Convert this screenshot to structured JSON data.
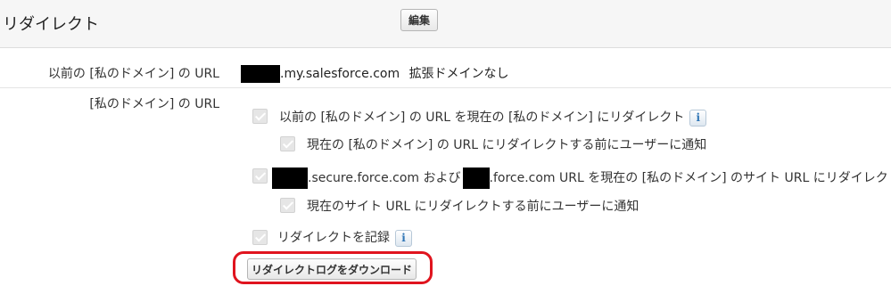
{
  "section": {
    "title": "リダイレクト",
    "edit_label": "編集"
  },
  "previous_domain": {
    "label": "以前の [私のドメイン] の URL",
    "domain_suffix": ".my.salesforce.com",
    "note": "拡張ドメインなし"
  },
  "redirect": {
    "label": "[私のドメイン] の URL",
    "options": [
      {
        "id": "redirect-to-current",
        "text": "以前の [私のドメイン] の URL を現在の [私のドメイン] にリダイレクト",
        "checked": true,
        "disabled": true,
        "has_info": true
      },
      {
        "id": "notify-before-redirect",
        "text": "現在の [私のドメイン] の URL にリダイレクトする前にユーザーに通知",
        "checked": true,
        "disabled": true
      },
      {
        "id": "redirect-sites",
        "text_part1": ".secure.force.com および",
        "text_part2": ".force.com URL を現在の [私のドメイン] のサイト URL にリダイレクト",
        "checked": true,
        "disabled": true
      },
      {
        "id": "notify-sites",
        "text": "現在のサイト URL にリダイレクトする前にユーザーに通知",
        "checked": true,
        "disabled": true
      },
      {
        "id": "log-redirects",
        "text": "リダイレクトを記録",
        "checked": true,
        "disabled": true,
        "has_info": true
      }
    ],
    "download_label": "リダイレクトログをダウンロード"
  },
  "icons": {
    "info": "i"
  },
  "colors": {
    "highlight": "#e0141e",
    "info": "#2f75b5"
  }
}
